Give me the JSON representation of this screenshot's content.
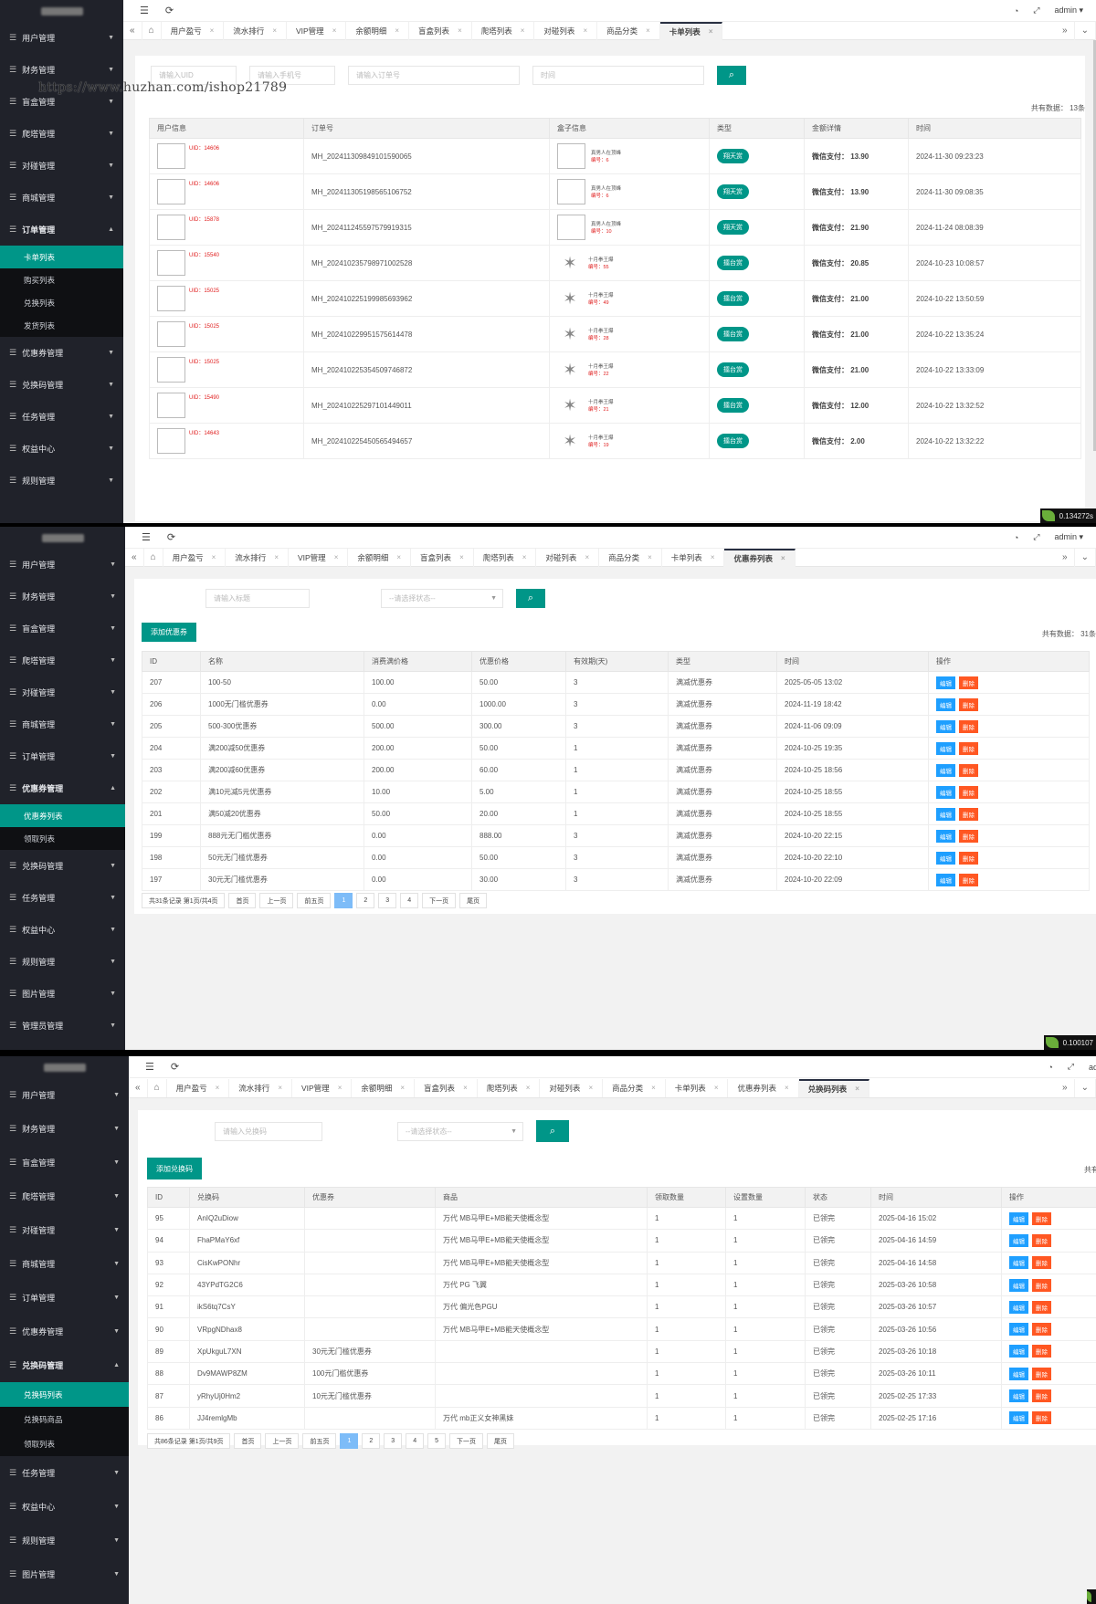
{
  "watermark": "https://www.huzhan.com/ishop21789",
  "common": {
    "admin_label": "admin",
    "menu_icon": "hamburger-icon",
    "refresh_icon": "refresh-icon"
  },
  "panel1": {
    "sidebar": [
      {
        "label": "用户管理"
      },
      {
        "label": "财务管理"
      },
      {
        "label": "盲盒管理"
      },
      {
        "label": "爬塔管理"
      },
      {
        "label": "对碰管理"
      },
      {
        "label": "商城管理"
      },
      {
        "label": "订单管理",
        "open": true,
        "children": [
          "卡单列表",
          "购买列表",
          "兑换列表",
          "发货列表"
        ],
        "active_child": 0
      },
      {
        "label": "优惠券管理"
      },
      {
        "label": "兑换码管理"
      },
      {
        "label": "任务管理"
      },
      {
        "label": "权益中心"
      },
      {
        "label": "规则管理"
      }
    ],
    "tabs": [
      "用户盈亏",
      "流水排行",
      "VIP管理",
      "余额明细",
      "盲盒列表",
      "爬塔列表",
      "对碰列表",
      "商品分类",
      "卡单列表"
    ],
    "active_tab": 8,
    "search": {
      "uid": "请输入UID",
      "phone": "请输入手机号",
      "order": "请输入订单号",
      "time": "时间"
    },
    "total": "共有数据：  13条",
    "columns": [
      "用户信息",
      "订单号",
      "盒子信息",
      "类型",
      "金额详情",
      "时间"
    ],
    "rows": [
      {
        "uid": "UID：14606",
        "order": "MH_20241130984910159​0065",
        "box": "真男人在顶峰",
        "no": "编号：6",
        "type": "翔天赏",
        "amount": "微信支付：  13.90",
        "time": "2024-11-30 09:23:23"
      },
      {
        "uid": "UID：14606",
        "order": "MH_20241130519856510​6752",
        "box": "真男人在顶峰",
        "no": "编号：6",
        "type": "翔天赏",
        "amount": "微信支付：  13.90",
        "time": "2024-11-30 09:08:35"
      },
      {
        "uid": "UID：15878",
        "order": "MH_20241124559757991​9315",
        "box": "真男人在顶峰",
        "no": "编号：10",
        "type": "翔天赏",
        "amount": "微信支付：  21.90",
        "time": "2024-11-24 08:08:39"
      },
      {
        "uid": "UID：15540",
        "order": "MH_20241023579897100​2528",
        "box": "十月拳王爆",
        "no": "编号：55",
        "type": "擂台赏",
        "amount": "微信支付：  20.85",
        "time": "2024-10-23 10:08:57"
      },
      {
        "uid": "UID：15025",
        "order": "MH_20241022519998569​3962",
        "box": "十月拳王爆",
        "no": "编号：49",
        "type": "擂台赏",
        "amount": "微信支付：  21.00",
        "time": "2024-10-22 13:50:59"
      },
      {
        "uid": "UID：15025",
        "order": "MH_20241022995157561​4478",
        "box": "十月拳王爆",
        "no": "编号：28",
        "type": "擂台赏",
        "amount": "微信支付：  21.00",
        "time": "2024-10-22 13:35:24"
      },
      {
        "uid": "UID：15025",
        "order": "MH_20241022535450974​6872",
        "box": "十月拳王爆",
        "no": "编号：22",
        "type": "擂台赏",
        "amount": "微信支付：  21.00",
        "time": "2024-10-22 13:33:09"
      },
      {
        "uid": "UID：15490",
        "order": "MH_20241022529710144​9011",
        "box": "十月拳王爆",
        "no": "编号：21",
        "type": "擂台赏",
        "amount": "微信支付：  12.00",
        "time": "2024-10-22 13:32:52"
      },
      {
        "uid": "UID：14643",
        "order": "MH_20241022545056549​4657",
        "box": "十月拳王爆",
        "no": "编号：19",
        "type": "擂台赏",
        "amount": "微信支付：  2.00",
        "time": "2024-10-22 13:32:22"
      }
    ],
    "speed": "0.134272s"
  },
  "panel2": {
    "sidebar": [
      {
        "label": "用户管理"
      },
      {
        "label": "财务管理"
      },
      {
        "label": "盲盒管理"
      },
      {
        "label": "爬塔管理"
      },
      {
        "label": "对碰管理"
      },
      {
        "label": "商城管理"
      },
      {
        "label": "订单管理"
      },
      {
        "label": "优惠券管理",
        "open": true,
        "children": [
          "优惠券列表",
          "领取列表"
        ],
        "active_child": 0
      },
      {
        "label": "兑换码管理"
      },
      {
        "label": "任务管理"
      },
      {
        "label": "权益中心"
      },
      {
        "label": "规则管理"
      },
      {
        "label": "图片管理"
      },
      {
        "label": "管理员管理"
      }
    ],
    "tabs": [
      "用户盈亏",
      "流水排行",
      "VIP管理",
      "余额明细",
      "盲盒列表",
      "爬塔列表",
      "对碰列表",
      "商品分类",
      "卡单列表",
      "优惠券列表"
    ],
    "active_tab": 9,
    "search": {
      "title": "请输入标题",
      "status": "--请选择状态--"
    },
    "add_label": "添加优惠券",
    "total": "共有数据：  31条",
    "columns": [
      "ID",
      "名称",
      "消费满价格",
      "优惠价格",
      "有效期(天)",
      "类型",
      "时间",
      "操作"
    ],
    "rows": [
      {
        "id": "207",
        "name": "100-50",
        "min": "100.00",
        "off": "50.00",
        "days": "3",
        "type": "满减优惠券",
        "time": "2025-05-05 13:02"
      },
      {
        "id": "206",
        "name": "1000无门槛优惠券",
        "min": "0.00",
        "off": "1000.00",
        "days": "3",
        "type": "满减优惠券",
        "time": "2024-11-19 18:42"
      },
      {
        "id": "205",
        "name": "500-300优惠券",
        "min": "500.00",
        "off": "300.00",
        "days": "3",
        "type": "满减优惠券",
        "time": "2024-11-06 09:09"
      },
      {
        "id": "204",
        "name": "满200减50优惠券",
        "min": "200.00",
        "off": "50.00",
        "days": "1",
        "type": "满减优惠券",
        "time": "2024-10-25 19:35"
      },
      {
        "id": "203",
        "name": "满200减60优惠券",
        "min": "200.00",
        "off": "60.00",
        "days": "1",
        "type": "满减优惠券",
        "time": "2024-10-25 18:56"
      },
      {
        "id": "202",
        "name": "满10元减5元优惠券",
        "min": "10.00",
        "off": "5.00",
        "days": "1",
        "type": "满减优惠券",
        "time": "2024-10-25 18:55"
      },
      {
        "id": "201",
        "name": "满50减20优惠券",
        "min": "50.00",
        "off": "20.00",
        "days": "1",
        "type": "满减优惠券",
        "time": "2024-10-25 18:55"
      },
      {
        "id": "199",
        "name": "888元无门槛优惠券",
        "min": "0.00",
        "off": "888.00",
        "days": "3",
        "type": "满减优惠券",
        "time": "2024-10-20 22:15"
      },
      {
        "id": "198",
        "name": "50元无门槛优惠券",
        "min": "0.00",
        "off": "50.00",
        "days": "3",
        "type": "满减优惠券",
        "time": "2024-10-20 22:10"
      },
      {
        "id": "197",
        "name": "30元无门槛优惠券",
        "min": "0.00",
        "off": "30.00",
        "days": "3",
        "type": "满减优惠券",
        "time": "2024-10-20 22:09"
      }
    ],
    "edit_label": "编辑",
    "delete_label": "删除",
    "pager": {
      "info": "共31条记录  第1页/共4页",
      "first": "首页",
      "prev": "上一页",
      "prev5": "前五页",
      "pages": [
        "1",
        "2",
        "3",
        "4"
      ],
      "current": 0,
      "next": "下一页",
      "last": "尾页"
    },
    "speed": "0.100107"
  },
  "panel3": {
    "sidebar": [
      {
        "label": "用户管理"
      },
      {
        "label": "财务管理"
      },
      {
        "label": "盲盒管理"
      },
      {
        "label": "爬塔管理"
      },
      {
        "label": "对碰管理"
      },
      {
        "label": "商城管理"
      },
      {
        "label": "订单管理"
      },
      {
        "label": "优惠券管理"
      },
      {
        "label": "兑换码管理",
        "open": true,
        "children": [
          "兑换码列表",
          "兑换码商品",
          "领取列表"
        ],
        "active_child": 0
      },
      {
        "label": "任务管理"
      },
      {
        "label": "权益中心"
      },
      {
        "label": "规则管理"
      },
      {
        "label": "图片管理"
      }
    ],
    "tabs": [
      "用户盈亏",
      "流水排行",
      "VIP管理",
      "余额明细",
      "盲盒列表",
      "爬塔列表",
      "对碰列表",
      "商品分类",
      "卡单列表",
      "优惠券列表",
      "兑换码列表"
    ],
    "active_tab": 10,
    "search": {
      "code": "请输入兑换码",
      "status": "--请选择状态--"
    },
    "add_label": "添加兑换码",
    "total": "共有数",
    "columns": [
      "ID",
      "兑换码",
      "优惠券",
      "商品",
      "领取数量",
      "设置数量",
      "状态",
      "时间",
      "操作"
    ],
    "rows": [
      {
        "id": "95",
        "code": "AnIQ2uDiow",
        "coupon": "",
        "goods": "万代 MB马甲E+MB能天使概念型",
        "got": "1",
        "set": "1",
        "status": "已领完",
        "time": "2025-04-16 15:02"
      },
      {
        "id": "94",
        "code": "FhaPMaY6xf",
        "coupon": "",
        "goods": "万代 MB马甲E+MB能天使概念型",
        "got": "1",
        "set": "1",
        "status": "已领完",
        "time": "2025-04-16 14:59"
      },
      {
        "id": "93",
        "code": "CisKwPONhr",
        "coupon": "",
        "goods": "万代 MB马甲E+MB能天使概念型",
        "got": "1",
        "set": "1",
        "status": "已领完",
        "time": "2025-04-16 14:58"
      },
      {
        "id": "92",
        "code": "43YPdTG2C6",
        "coupon": "",
        "goods": "万代 PG 飞翼",
        "got": "1",
        "set": "1",
        "status": "已领完",
        "time": "2025-03-26 10:58"
      },
      {
        "id": "91",
        "code": "ikS6tq7CsY",
        "coupon": "",
        "goods": "万代 偏光色PGU",
        "got": "1",
        "set": "1",
        "status": "已领完",
        "time": "2025-03-26 10:57"
      },
      {
        "id": "90",
        "code": "VRpgNDhax8",
        "coupon": "",
        "goods": "万代 MB马甲E+MB能天使概念型",
        "got": "1",
        "set": "1",
        "status": "已领完",
        "time": "2025-03-26 10:56"
      },
      {
        "id": "89",
        "code": "XpUkguL7XN",
        "coupon": "30元无门槛优惠券",
        "goods": "",
        "got": "1",
        "set": "1",
        "status": "已领完",
        "time": "2025-03-26 10:18"
      },
      {
        "id": "88",
        "code": "Dv9MAWP8ZM",
        "coupon": "100元门槛优惠券",
        "goods": "",
        "got": "1",
        "set": "1",
        "status": "已领完",
        "time": "2025-03-26 10:11"
      },
      {
        "id": "87",
        "code": "yRhyUj0Hm2",
        "coupon": "10元无门槛优惠券",
        "goods": "",
        "got": "1",
        "set": "1",
        "status": "已领完",
        "time": "2025-02-25 17:33"
      },
      {
        "id": "86",
        "code": "JJ4remlgMb",
        "coupon": "",
        "goods": "万代 mb正义女神黑妹",
        "got": "1",
        "set": "1",
        "status": "已领完",
        "time": "2025-02-25 17:16"
      }
    ],
    "edit_label": "编辑",
    "delete_label": "删除",
    "pager": {
      "info": "共86条记录  第1页/共9页",
      "first": "首页",
      "prev": "上一页",
      "prev5": "前五页",
      "pages": [
        "1",
        "2",
        "3",
        "4",
        "5"
      ],
      "current": 0,
      "next": "下一页",
      "last": "尾页"
    }
  }
}
